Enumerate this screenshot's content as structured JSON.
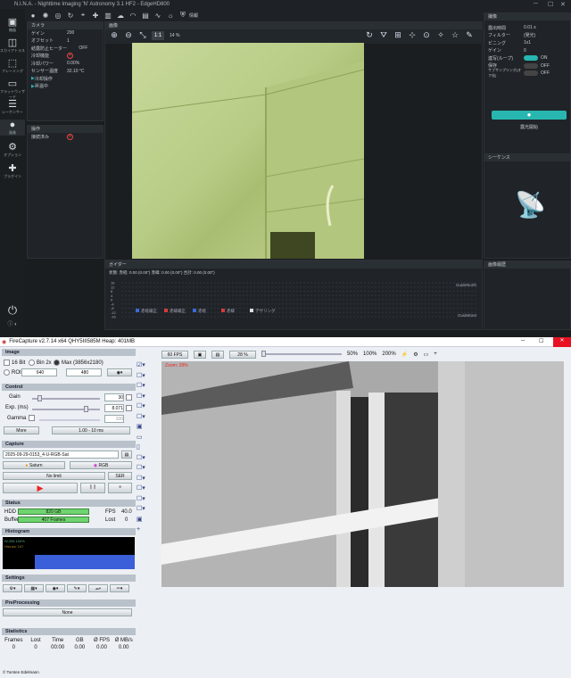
{
  "nina": {
    "title": "N.I.N.A. - Nighttime Imaging 'N' Astronomy 3.1 HF2 - EdgeHD800",
    "sidebar": [
      {
        "icon": "equipment-icon",
        "label": "機器"
      },
      {
        "icon": "sky-atlas-icon",
        "label": "スカイアトラス"
      },
      {
        "icon": "framing-icon",
        "label": "フレーミング"
      },
      {
        "icon": "flat-wizard-icon",
        "label": "フラットウィザード"
      },
      {
        "icon": "sequencer-icon",
        "label": "シーケンサー"
      },
      {
        "icon": "imaging-icon",
        "label": "画像"
      },
      {
        "icon": "options-icon",
        "label": "オプション"
      },
      {
        "icon": "plugins-icon",
        "label": "プラグイン"
      }
    ],
    "camera": {
      "title": "カメラ",
      "rows": [
        [
          "ゲイン",
          "200"
        ],
        [
          "オフセット",
          "1"
        ],
        [
          "結露防止ヒーター",
          "OFF"
        ],
        [
          "冷却機能",
          ""
        ],
        [
          "冷却パワー",
          "0.00%"
        ],
        [
          "センサー温度",
          "32.10 °C"
        ]
      ],
      "actions": [
        "冷却操作",
        "昇温中"
      ]
    },
    "guider": {
      "title": "操作",
      "row": "接続済み"
    },
    "image_panel": {
      "title": "画像",
      "zoom_label": "1:1",
      "zoom_pct": "14 %"
    },
    "imaging": {
      "title": "撮像",
      "rows": [
        [
          "露出時間",
          "0.01 s"
        ],
        [
          "フィルター",
          "(発光)"
        ],
        [
          "ビニング",
          "1x1"
        ],
        [
          "ゲイン",
          "0"
        ],
        [
          "連写(ループ)",
          "ON"
        ],
        [
          "保存",
          "OFF"
        ],
        [
          "サブサンプリング(オフ化)",
          "OFF"
        ]
      ],
      "start": "露光開始"
    },
    "sequence": {
      "title": "シーケンス"
    },
    "guide": {
      "title": "ガイダー",
      "status": "状態: 赤経: 0.00 (0.00\") 赤緯: 0.00 (0.00\") 合計: 0.00 (0.00\")",
      "yticks": [
        "16",
        "12",
        "8",
        "4",
        "0",
        "-4",
        "-8",
        "-12",
        "-16"
      ],
      "north": "GuideNorth",
      "east": "GuideEast",
      "legend": [
        "赤経補正",
        "赤緯補正",
        "赤経",
        "赤緯",
        "デザリング"
      ]
    },
    "history": {
      "title": "画像履歴"
    }
  },
  "fc": {
    "title": "FireCapture v2.7.14 x64   QHY5III585M   Heap: 401MB",
    "image": {
      "title": "Image",
      "bits16": "16 Bit",
      "bin2": "Bin 2x",
      "max": "Max (3856x2180)",
      "roi": "ROI",
      "w": "640",
      "h": "480"
    },
    "control": {
      "title": "Control",
      "gain": "Gain",
      "gain_v": "30",
      "exp": "Exp. (ms)",
      "exp_v": "8.071",
      "gamma": "Gamma",
      "gamma_v": "100",
      "more": "More",
      "range": "1.00 - 10 ms"
    },
    "capture": {
      "title": "Capture",
      "file": "2025-09-29-0153_4-U-RGB-Sat",
      "obj": "Saturn",
      "rgb": "RGB",
      "limit": "No limit",
      "ser": "SER"
    },
    "status": {
      "title": "Status",
      "hdd_k": "HDD",
      "hdd_v": "820 GB",
      "fps_k": "FPS",
      "fps_v": "40.0",
      "buf_k": "Buffer",
      "buf_v": "407 Frames",
      "lost_k": "Lost",
      "lost_v": "0"
    },
    "histogram": {
      "title": "Histogram",
      "max": "W:255 100%",
      "avg": "Hist.avr 247"
    },
    "settings": {
      "title": "Settings"
    },
    "pre": {
      "title": "PreProcessing",
      "none": "None"
    },
    "stats": {
      "title": "Statistics",
      "headers": [
        "Frames",
        "Lost",
        "Time",
        "GB",
        "Ø FPS",
        "Ø MB/s"
      ],
      "values": [
        "0",
        "0",
        "00:00",
        "0.00",
        "0.00",
        "0.00"
      ]
    },
    "toolbar": {
      "fps": "60 FPS",
      "zoom": "28 %",
      "z50": "50%",
      "z100": "100%",
      "z200": "200%"
    },
    "zoom_text": "Zoom: 28%",
    "credit": "© Torsten Edelmann"
  }
}
